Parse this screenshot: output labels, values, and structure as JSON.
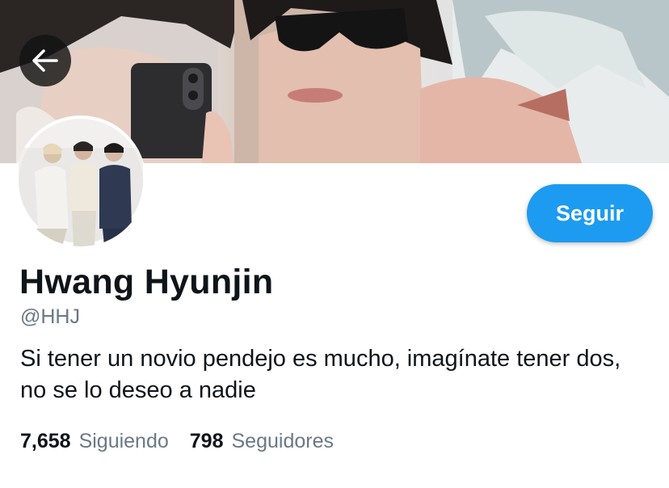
{
  "profile": {
    "display_name": "Hwang Hyunjin",
    "handle": "@HHJ",
    "bio": "Si tener un novio pendejo es mucho, imagínate tener dos, no se lo deseo a nadie"
  },
  "actions": {
    "follow_label": "Seguir",
    "back_icon": "arrow-left-icon"
  },
  "stats": {
    "following_count": "7,658",
    "following_label": "Siguiendo",
    "followers_count": "798",
    "followers_label": "Seguidores"
  },
  "colors": {
    "accent": "#1d9bf0",
    "text_primary": "#0f1419",
    "text_secondary": "#6b7886",
    "background": "#ffffff"
  }
}
